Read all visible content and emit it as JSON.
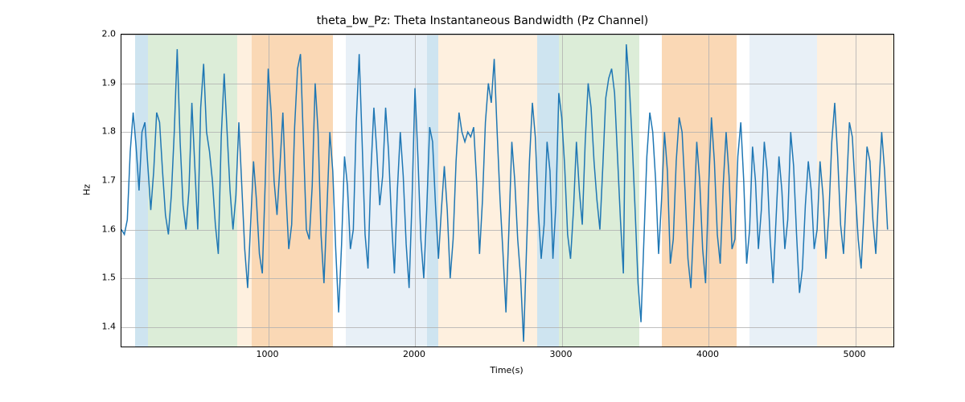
{
  "chart_data": {
    "type": "line",
    "title": "theta_bw_Pz: Theta Instantaneous Bandwidth (Pz Channel)",
    "xlabel": "Time(s)",
    "ylabel": "Hz",
    "xlim": [
      0,
      5260
    ],
    "ylim": [
      1.36,
      2.0
    ],
    "xticks": [
      1000,
      2000,
      3000,
      4000,
      5000
    ],
    "yticks": [
      1.4,
      1.5,
      1.6,
      1.7,
      1.8,
      1.9,
      2.0
    ],
    "bands": [
      {
        "x0": 95,
        "x1": 180,
        "color": "#9ec9e2"
      },
      {
        "x0": 180,
        "x1": 790,
        "color": "#b9dcb1"
      },
      {
        "x0": 790,
        "x1": 890,
        "color": "#fde1c0"
      },
      {
        "x0": 890,
        "x1": 1440,
        "color": "#f6b26b"
      },
      {
        "x0": 1440,
        "x1": 1530,
        "color": "#ffffff"
      },
      {
        "x0": 1530,
        "x1": 2080,
        "color": "#d1e1f0"
      },
      {
        "x0": 2080,
        "x1": 2160,
        "color": "#9ec9e2"
      },
      {
        "x0": 2160,
        "x1": 2830,
        "color": "#fde1c0"
      },
      {
        "x0": 2830,
        "x1": 2980,
        "color": "#9ec9e2"
      },
      {
        "x0": 2980,
        "x1": 3530,
        "color": "#b9dcb1"
      },
      {
        "x0": 3530,
        "x1": 3680,
        "color": "#ffffff"
      },
      {
        "x0": 3680,
        "x1": 4190,
        "color": "#f6b26b"
      },
      {
        "x0": 4190,
        "x1": 4280,
        "color": "#ffffff"
      },
      {
        "x0": 4280,
        "x1": 4740,
        "color": "#d1e1f0"
      },
      {
        "x0": 4740,
        "x1": 5260,
        "color": "#fde1c0"
      }
    ],
    "series": [
      {
        "name": "theta_bw_Pz",
        "color": "#1f77b4",
        "x_step": 20,
        "x_start": 0,
        "values": [
          1.6,
          1.59,
          1.62,
          1.76,
          1.84,
          1.77,
          1.68,
          1.8,
          1.82,
          1.73,
          1.64,
          1.72,
          1.84,
          1.82,
          1.72,
          1.63,
          1.59,
          1.67,
          1.8,
          1.97,
          1.78,
          1.65,
          1.6,
          1.68,
          1.86,
          1.73,
          1.6,
          1.85,
          1.94,
          1.8,
          1.76,
          1.7,
          1.61,
          1.55,
          1.79,
          1.92,
          1.8,
          1.68,
          1.6,
          1.67,
          1.82,
          1.69,
          1.56,
          1.48,
          1.61,
          1.74,
          1.66,
          1.55,
          1.51,
          1.7,
          1.93,
          1.84,
          1.7,
          1.63,
          1.73,
          1.84,
          1.68,
          1.56,
          1.61,
          1.81,
          1.93,
          1.96,
          1.78,
          1.6,
          1.58,
          1.69,
          1.9,
          1.8,
          1.59,
          1.49,
          1.64,
          1.8,
          1.72,
          1.56,
          1.43,
          1.57,
          1.75,
          1.69,
          1.56,
          1.6,
          1.82,
          1.96,
          1.78,
          1.59,
          1.52,
          1.72,
          1.85,
          1.76,
          1.65,
          1.71,
          1.85,
          1.76,
          1.62,
          1.51,
          1.68,
          1.8,
          1.71,
          1.57,
          1.48,
          1.66,
          1.89,
          1.75,
          1.58,
          1.5,
          1.64,
          1.81,
          1.78,
          1.65,
          1.54,
          1.64,
          1.73,
          1.64,
          1.5,
          1.58,
          1.74,
          1.84,
          1.8,
          1.78,
          1.8,
          1.79,
          1.81,
          1.7,
          1.55,
          1.66,
          1.82,
          1.9,
          1.86,
          1.95,
          1.8,
          1.66,
          1.55,
          1.43,
          1.6,
          1.78,
          1.7,
          1.58,
          1.5,
          1.37,
          1.56,
          1.74,
          1.86,
          1.79,
          1.64,
          1.54,
          1.61,
          1.78,
          1.72,
          1.54,
          1.65,
          1.88,
          1.83,
          1.73,
          1.59,
          1.54,
          1.64,
          1.78,
          1.68,
          1.61,
          1.78,
          1.9,
          1.85,
          1.74,
          1.66,
          1.6,
          1.73,
          1.87,
          1.91,
          1.93,
          1.88,
          1.75,
          1.62,
          1.51,
          1.98,
          1.9,
          1.78,
          1.64,
          1.49,
          1.41,
          1.58,
          1.75,
          1.84,
          1.8,
          1.7,
          1.55,
          1.66,
          1.8,
          1.72,
          1.53,
          1.58,
          1.74,
          1.83,
          1.8,
          1.68,
          1.54,
          1.48,
          1.62,
          1.78,
          1.7,
          1.56,
          1.49,
          1.68,
          1.83,
          1.74,
          1.59,
          1.53,
          1.69,
          1.8,
          1.71,
          1.56,
          1.58,
          1.75,
          1.82,
          1.7,
          1.53,
          1.6,
          1.77,
          1.7,
          1.56,
          1.64,
          1.78,
          1.72,
          1.58,
          1.49,
          1.62,
          1.75,
          1.68,
          1.56,
          1.62,
          1.8,
          1.73,
          1.59,
          1.47,
          1.52,
          1.65,
          1.74,
          1.68,
          1.56,
          1.6,
          1.74,
          1.67,
          1.54,
          1.63,
          1.78,
          1.86,
          1.75,
          1.61,
          1.55,
          1.68,
          1.82,
          1.79,
          1.68,
          1.58,
          1.52,
          1.64,
          1.77,
          1.74,
          1.62,
          1.55,
          1.68,
          1.8,
          1.72,
          1.6
        ]
      }
    ]
  }
}
